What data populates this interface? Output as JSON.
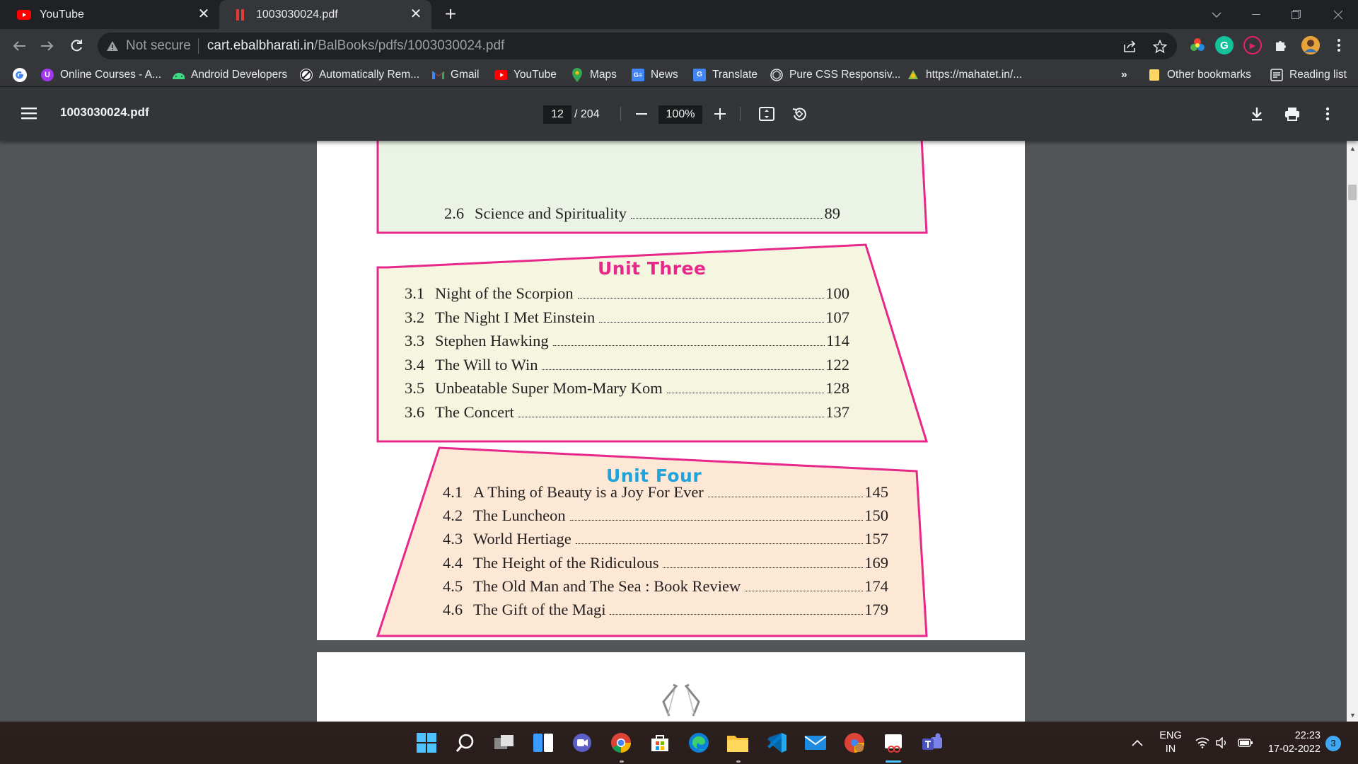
{
  "browser": {
    "tabs": [
      {
        "title": "YouTube"
      },
      {
        "title": "1003030024.pdf"
      }
    ],
    "new_tab_symbol": "+",
    "address": {
      "security_label": "Not secure",
      "host": "cart.ebalbharati.in",
      "path": "/BalBooks/pdfs/1003030024.pdf"
    },
    "bookmarks": [
      {
        "label": "Online Courses - A...",
        "icon": "udemy-icon"
      },
      {
        "label": "Android Developers",
        "icon": "android-icon"
      },
      {
        "label": "Automatically Rem...",
        "icon": "remove-icon"
      },
      {
        "label": "Gmail",
        "icon": "gmail-icon"
      },
      {
        "label": "YouTube",
        "icon": "youtube-icon"
      },
      {
        "label": "Maps",
        "icon": "maps-icon"
      },
      {
        "label": "News",
        "icon": "news-icon"
      },
      {
        "label": "Translate",
        "icon": "translate-icon"
      },
      {
        "label": "Pure CSS Responsiv...",
        "icon": "codepen-icon"
      },
      {
        "label": "https://mahatet.in/...",
        "icon": "globe-icon"
      }
    ],
    "more_bookmarks": "»",
    "other_bookmarks": "Other bookmarks",
    "reading_list": "Reading list"
  },
  "pdf_viewer": {
    "filename": "1003030024.pdf",
    "current_page": "12",
    "total_pages": "/ 204",
    "zoom": "100%"
  },
  "document": {
    "unit2_last": {
      "num": "2.6",
      "title": "Science and Spirituality",
      "page": "89"
    },
    "unit3": {
      "heading": "Unit   Three",
      "items": [
        {
          "num": "3.1",
          "title": "Night of the Scorpion",
          "page": "100"
        },
        {
          "num": "3.2",
          "title": "The Night I Met Einstein",
          "page": "107"
        },
        {
          "num": "3.3",
          "title": "Stephen Hawking",
          "page": "114"
        },
        {
          "num": "3.4",
          "title": "The Will to Win",
          "page": "122"
        },
        {
          "num": "3.5",
          "title": "Unbeatable Super Mom-Mary Kom",
          "page": "128"
        },
        {
          "num": "3.6",
          "title": "The Concert",
          "page": "137"
        }
      ]
    },
    "unit4": {
      "heading": "Unit   Four",
      "items": [
        {
          "num": "4.1",
          "title": "A Thing of Beauty is a Joy For Ever",
          "page": "145"
        },
        {
          "num": "4.2",
          "title": "The Luncheon",
          "page": "150"
        },
        {
          "num": "4.3",
          "title": "World Hertiage",
          "page": "157"
        },
        {
          "num": "4.4",
          "title": "The Height of the Ridiculous",
          "page": "169"
        },
        {
          "num": "4.5",
          "title": "The Old Man and The Sea : Book Review",
          "page": "174"
        },
        {
          "num": "4.6",
          "title": "The Gift of the Magi",
          "page": "179"
        }
      ]
    }
  },
  "taskbar": {
    "language": "ENG",
    "region": "IN",
    "time": "22:23",
    "date": "17-02-2022",
    "notifications": "3"
  },
  "colors": {
    "unit_border": "#e8278b",
    "unit3_fill": "#f4f6e0",
    "unit4_fill": "#fde9d9",
    "unit3_title": "#e8278b",
    "unit4_title": "#1fa3dc"
  }
}
